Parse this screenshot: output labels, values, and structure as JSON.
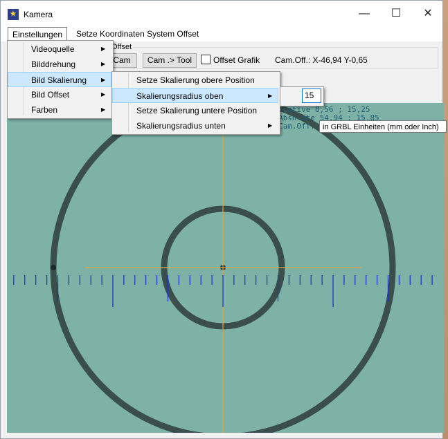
{
  "window": {
    "title": "Kamera",
    "controls": {
      "minimize": "—",
      "maximize": "☐",
      "close": "✕"
    }
  },
  "menubar": {
    "items": [
      {
        "label": "Einstellungen"
      },
      {
        "label": "Setze Koordinaten System Offset"
      }
    ]
  },
  "toolbar": {
    "group_label": "Offset",
    "cam_button": "Cam",
    "cam_tool_button": "Cam .> Tool",
    "offset_grafik_label": "Offset Grafik",
    "offset_grafik_checked": false,
    "cam_offset_text": "Cam.Off.: X-46,94 Y-0,65"
  },
  "einstellungen_menu": {
    "items": [
      {
        "label": "Videoquelle",
        "submenu": true
      },
      {
        "label": "Bilddrehung",
        "submenu": true
      },
      {
        "label": "Bild Skalierung",
        "submenu": true,
        "highlighted": true
      },
      {
        "label": "Bild Offset",
        "submenu": true
      },
      {
        "label": "Farben",
        "submenu": true
      }
    ]
  },
  "skalierung_menu": {
    "items": [
      {
        "label": "Setze Skalierung obere Position",
        "submenu": false
      },
      {
        "label": "Skalierungsradius oben",
        "submenu": true,
        "highlighted": true
      },
      {
        "label": "Setze Skalierung untere Position",
        "submenu": false
      },
      {
        "label": "Skalierungsradius unten",
        "submenu": true
      }
    ]
  },
  "radius_input": {
    "value": "15"
  },
  "tooltip": "in GRBL Einheiten (mm oder Inch)",
  "camera_overlay": {
    "relative": "elative 8,56 ; 15,25",
    "absolute": "Absolute 54,94 ; 15,85",
    "cam_off": "Cam.Off."
  },
  "colors": {
    "crosshair": "#e8a23a",
    "ruler": "#1a2fbf",
    "rings": "#2e3d3c",
    "camera_bg": "#7db0a6",
    "menu_highlight": "#cce8ff"
  }
}
